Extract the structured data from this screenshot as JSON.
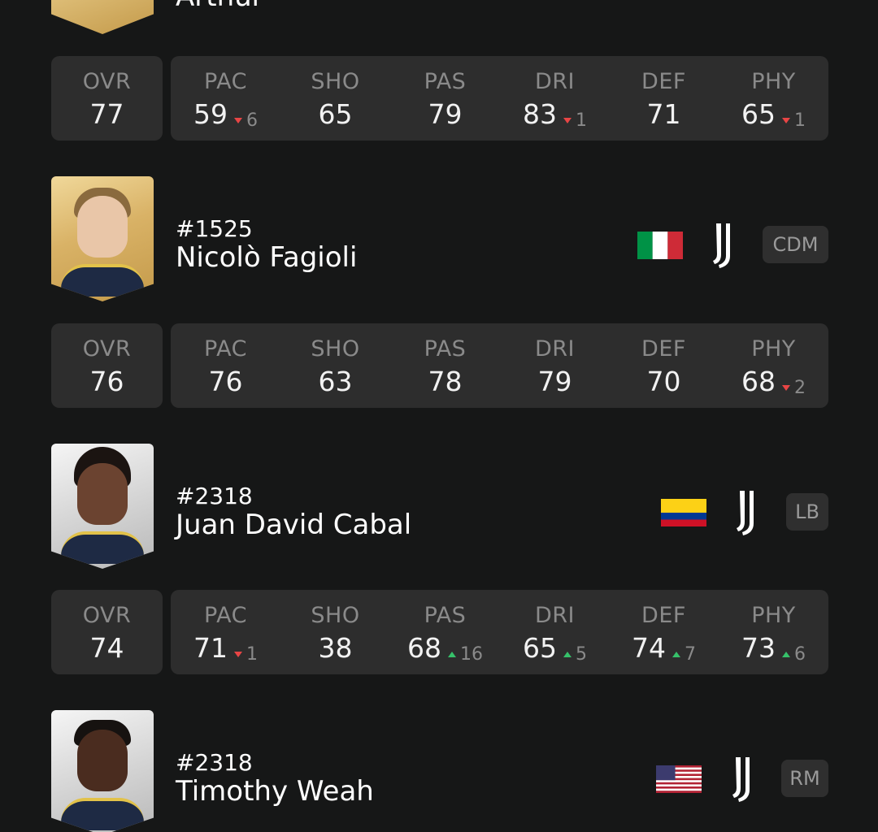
{
  "partial_top": {
    "name": "Arthur"
  },
  "rows": [
    {
      "ovr_label": "OVR",
      "ovr": "77",
      "stats": [
        {
          "label": "PAC",
          "value": "59",
          "delta": "6",
          "dir": "down"
        },
        {
          "label": "SHO",
          "value": "65",
          "delta": "",
          "dir": ""
        },
        {
          "label": "PAS",
          "value": "79",
          "delta": "",
          "dir": ""
        },
        {
          "label": "DRI",
          "value": "83",
          "delta": "1",
          "dir": "down"
        },
        {
          "label": "DEF",
          "value": "71",
          "delta": "",
          "dir": ""
        },
        {
          "label": "PHY",
          "value": "65",
          "delta": "1",
          "dir": "down"
        }
      ]
    },
    {
      "ovr_label": "OVR",
      "ovr": "76",
      "stats": [
        {
          "label": "PAC",
          "value": "76",
          "delta": "",
          "dir": ""
        },
        {
          "label": "SHO",
          "value": "63",
          "delta": "",
          "dir": ""
        },
        {
          "label": "PAS",
          "value": "78",
          "delta": "",
          "dir": ""
        },
        {
          "label": "DRI",
          "value": "79",
          "delta": "",
          "dir": ""
        },
        {
          "label": "DEF",
          "value": "70",
          "delta": "",
          "dir": ""
        },
        {
          "label": "PHY",
          "value": "68",
          "delta": "2",
          "dir": "down"
        }
      ]
    },
    {
      "ovr_label": "OVR",
      "ovr": "74",
      "stats": [
        {
          "label": "PAC",
          "value": "71",
          "delta": "1",
          "dir": "down"
        },
        {
          "label": "SHO",
          "value": "38",
          "delta": "",
          "dir": ""
        },
        {
          "label": "PAS",
          "value": "68",
          "delta": "16",
          "dir": "up"
        },
        {
          "label": "DRI",
          "value": "65",
          "delta": "5",
          "dir": "up"
        },
        {
          "label": "DEF",
          "value": "74",
          "delta": "7",
          "dir": "up"
        },
        {
          "label": "PHY",
          "value": "73",
          "delta": "6",
          "dir": "up"
        }
      ]
    }
  ],
  "players": [
    {
      "number": "#1525",
      "name": "Nicolò Fagioli",
      "position": "CDM",
      "flag": "italy-flag",
      "club": "juventus-logo",
      "card": "gold"
    },
    {
      "number": "#2318",
      "name": "Juan David Cabal",
      "position": "LB",
      "flag": "colombia-flag",
      "club": "juventus-logo",
      "card": "silver"
    },
    {
      "number": "#2318",
      "name": "Timothy Weah",
      "position": "RM",
      "flag": "usa-flag",
      "club": "juventus-logo",
      "card": "silver"
    }
  ],
  "colors": {
    "background": "#161717",
    "panel": "#2d2d2d",
    "delta_down": "#e84545",
    "delta_up": "#36c16a"
  }
}
